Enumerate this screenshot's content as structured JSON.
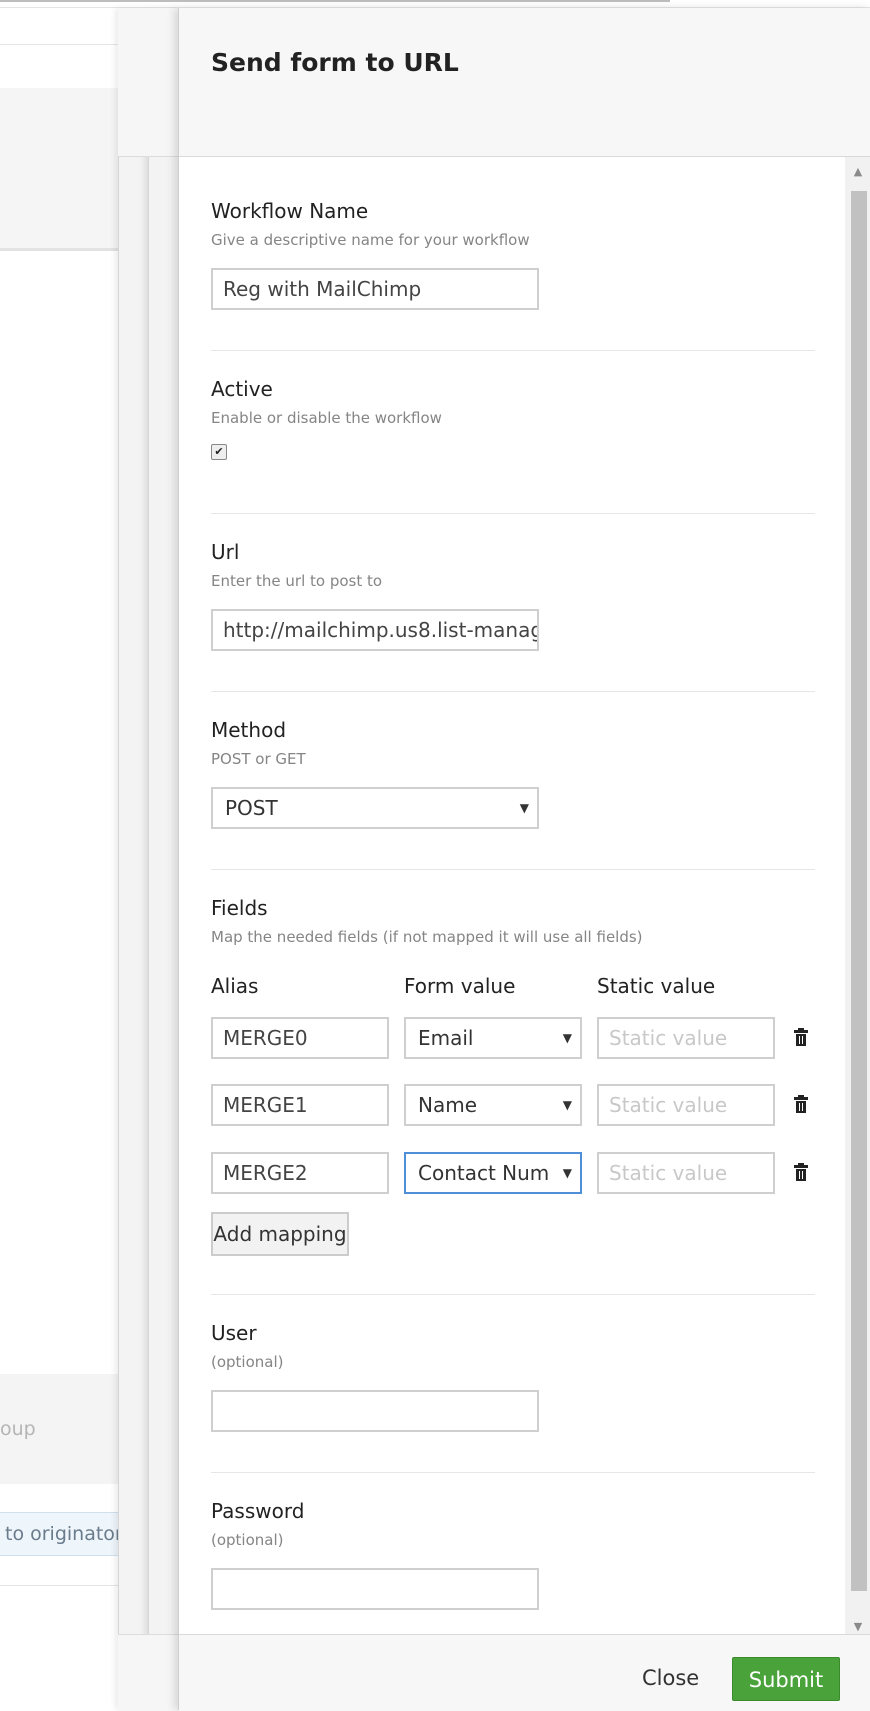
{
  "background": {
    "group_fragment": "oup",
    "originator_fragment": "to originator"
  },
  "panel": {
    "title": "Send form to URL"
  },
  "workflow_name": {
    "label": "Workflow Name",
    "description": "Give a descriptive name for your workflow",
    "value": "Reg with MailChimp"
  },
  "active": {
    "label": "Active",
    "description": "Enable or disable the workflow",
    "checked": true,
    "check_glyph": "✔"
  },
  "url": {
    "label": "Url",
    "description": "Enter the url to post to",
    "value": "http://mailchimp.us8.list-manag"
  },
  "method": {
    "label": "Method",
    "description": "POST or GET",
    "selected": "POST"
  },
  "fields": {
    "label": "Fields",
    "description": "Map the needed fields (if not mapped it will use all fields)",
    "col_alias": "Alias",
    "col_form_value": "Form value",
    "col_static_value": "Static value",
    "static_placeholder": "Static value",
    "rows": [
      {
        "alias": "MERGE0",
        "form_value": "Email"
      },
      {
        "alias": "MERGE1",
        "form_value": "Name"
      },
      {
        "alias": "MERGE2",
        "form_value": "Contact Num"
      }
    ],
    "add_mapping_label": "Add mapping"
  },
  "user": {
    "label": "User",
    "description": "(optional)",
    "value": ""
  },
  "password": {
    "label": "Password",
    "description": "(optional)",
    "value": ""
  },
  "footer": {
    "close_label": "Close",
    "submit_label": "Submit"
  },
  "icons": {
    "select_caret": "▼",
    "scroll_up": "▲",
    "scroll_down": "▼",
    "trash": "trash-icon"
  },
  "colors": {
    "submit_green": "#4aa33a",
    "focus_blue": "#4e8fd8"
  }
}
